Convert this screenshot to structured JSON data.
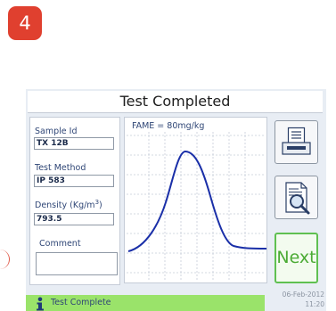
{
  "step_badge": "4",
  "title": "Test Completed",
  "fields": {
    "sample_id": {
      "label": "Sample Id",
      "value": "TX 12B"
    },
    "test_method": {
      "label": "Test Method",
      "value": "IP 583"
    },
    "density": {
      "label_prefix": "Density (Kg/m",
      "label_sup": "3",
      "label_suffix": ")",
      "value": "793.5"
    },
    "comment": {
      "label": "Comment",
      "value": ""
    }
  },
  "chart": {
    "annotation": "FAME = 80mg/kg",
    "curve_color": "#1a2fa8"
  },
  "buttons": {
    "print": "printer-icon",
    "view_report": "document-search-icon",
    "next_label": "Next"
  },
  "status": {
    "text": "Test Complete",
    "date": "06-Feb-2012",
    "time": "11:20"
  },
  "colors": {
    "accent_badge": "#e0402f",
    "status_green": "#9ae36a",
    "next_green": "#4bab35",
    "label_blue": "#2f4676"
  }
}
